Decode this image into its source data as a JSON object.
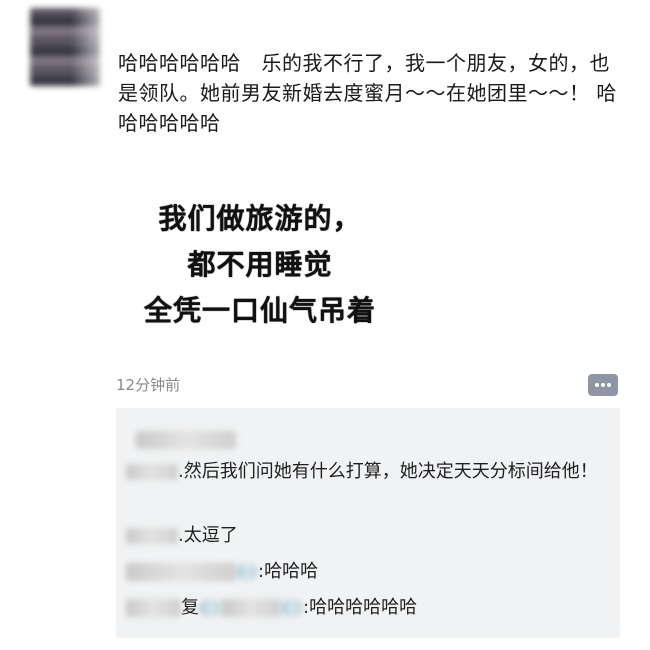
{
  "post": {
    "text": "哈哈哈哈哈哈　乐的我不行了，我一个朋友，女的，也是领队。她前男友新婚去度蜜月～～在她团里～～！ 哈哈哈哈哈哈",
    "image_lines": [
      "我们做旅游的，",
      "都不用睡觉",
      "全凭一口仙气吊着"
    ],
    "timestamp": "12分钟前"
  },
  "comments": [
    {
      "sep": ".",
      "text": "然后我们问她有什么打算，她决定天天分标间给他！"
    },
    {
      "sep": ".",
      "text": "太逗了"
    },
    {
      "sep": ":",
      "text": "哈哈哈"
    },
    {
      "reply_word": "复",
      "sep": ":",
      "text": "哈哈哈哈哈哈"
    }
  ]
}
